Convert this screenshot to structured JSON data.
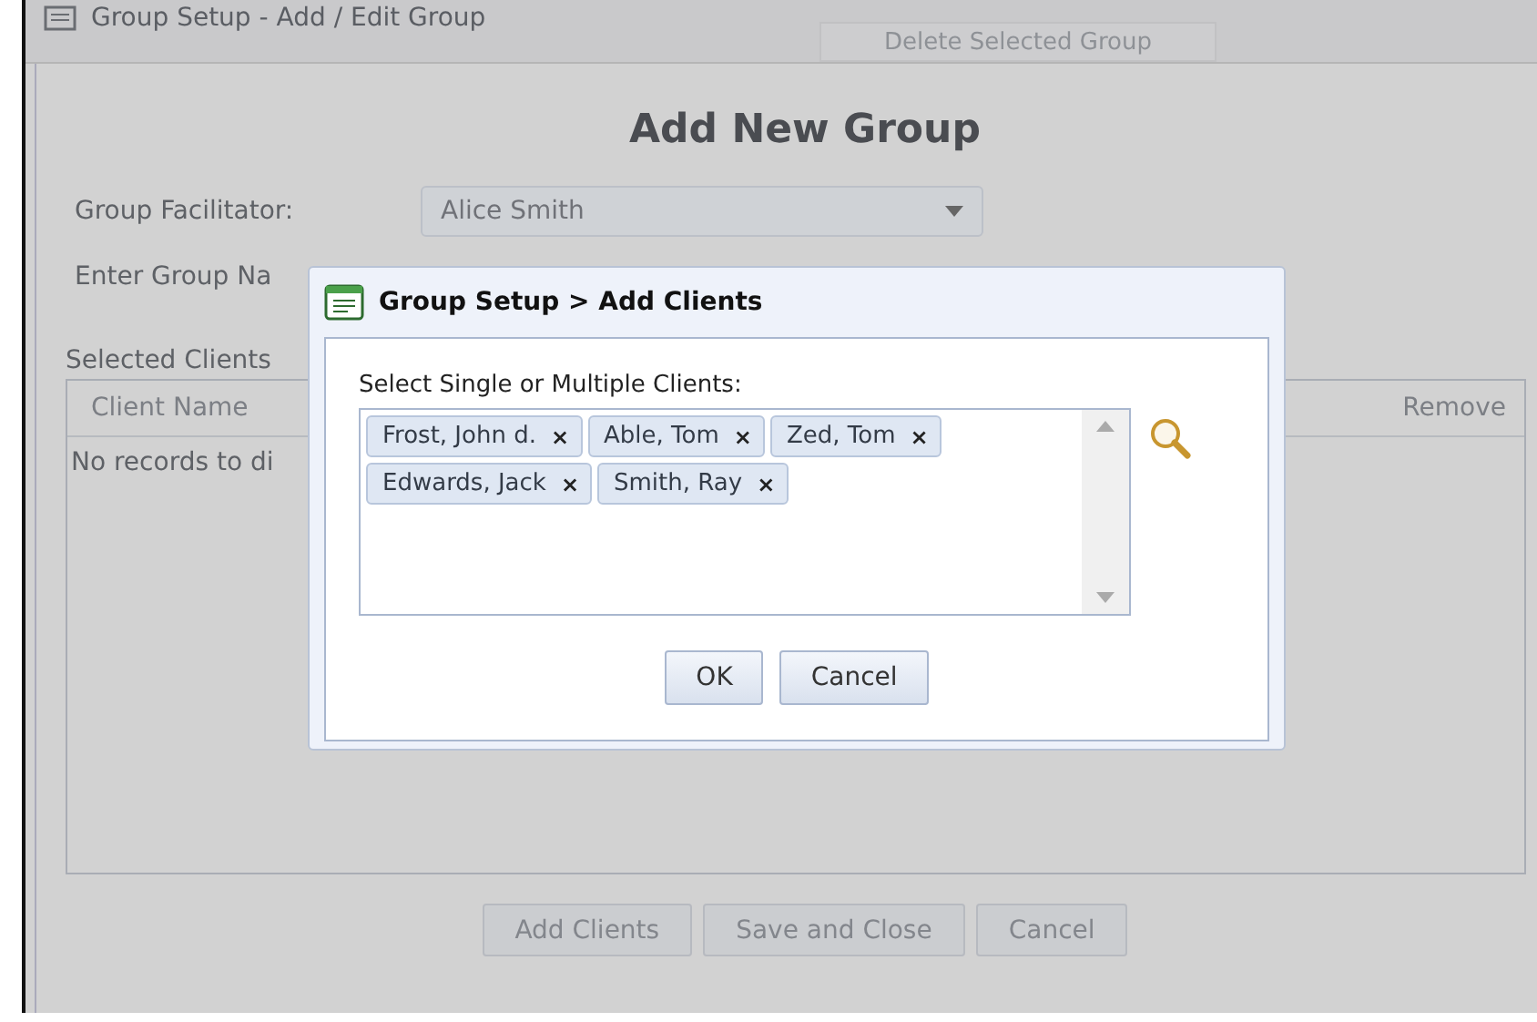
{
  "window": {
    "title": "Group Setup - Add / Edit Group",
    "toolbar_button": "Delete Selected Group"
  },
  "heading": "Add New Group",
  "facilitator": {
    "label": "Group Facilitator:",
    "value": "Alice Smith"
  },
  "group_name": {
    "label": "Enter Group Na"
  },
  "selected_clients": {
    "label": "Selected Clients",
    "columns": [
      "Client Name",
      "Remove"
    ],
    "empty_text": "No records to di"
  },
  "buttons": [
    "Add Clients",
    "Save and Close",
    "Cancel"
  ],
  "dialog": {
    "title": "Group Setup > Add Clients",
    "label": "Select Single or Multiple Clients:",
    "clients": [
      {
        "name": "Frost, John d.",
        "remove": "×"
      },
      {
        "name": "Able, Tom",
        "remove": "×"
      },
      {
        "name": "Zed, Tom",
        "remove": "×"
      },
      {
        "name": "Edwards, Jack",
        "remove": "×"
      },
      {
        "name": "Smith, Ray",
        "remove": "×"
      }
    ],
    "buttons": [
      "OK",
      "Cancel"
    ]
  }
}
